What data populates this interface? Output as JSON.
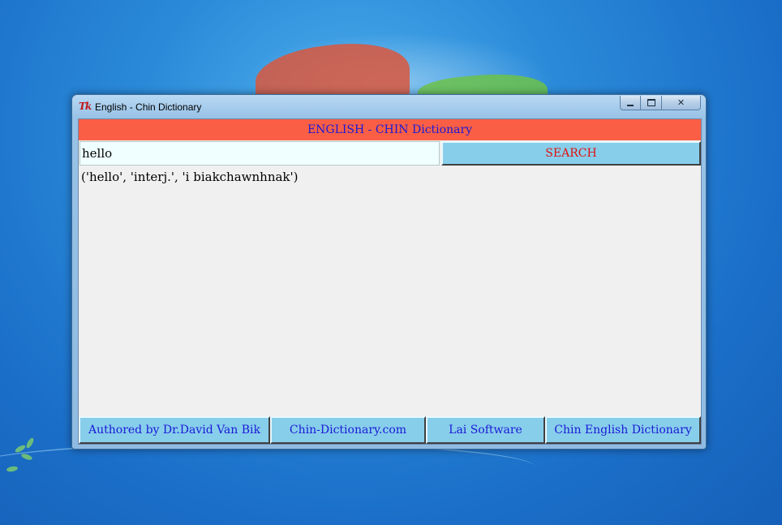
{
  "window": {
    "title": "English - Chin Dictionary",
    "icon_label": "Tk",
    "caption": {
      "minimize": "minimize-icon",
      "maximize": "maximize-icon",
      "close_glyph": "✕"
    }
  },
  "header": {
    "title": "ENGLISH - CHIN Dictionary"
  },
  "search": {
    "value": "hello",
    "button_label": "SEARCH"
  },
  "result": {
    "text": "('hello', 'interj.', 'i biakchawnhnak')"
  },
  "footer": {
    "buttons": [
      {
        "label": "Authored by Dr.David Van Bik"
      },
      {
        "label": "Chin-Dictionary.com"
      },
      {
        "label": "Lai Software"
      },
      {
        "label": "Chin English Dictionary"
      }
    ]
  },
  "colors": {
    "header_bg": "#fa5f45",
    "header_text": "#1a1ad6",
    "button_bg": "#87ceeb",
    "search_text": "#e01010",
    "input_bg": "#f0ffff"
  }
}
